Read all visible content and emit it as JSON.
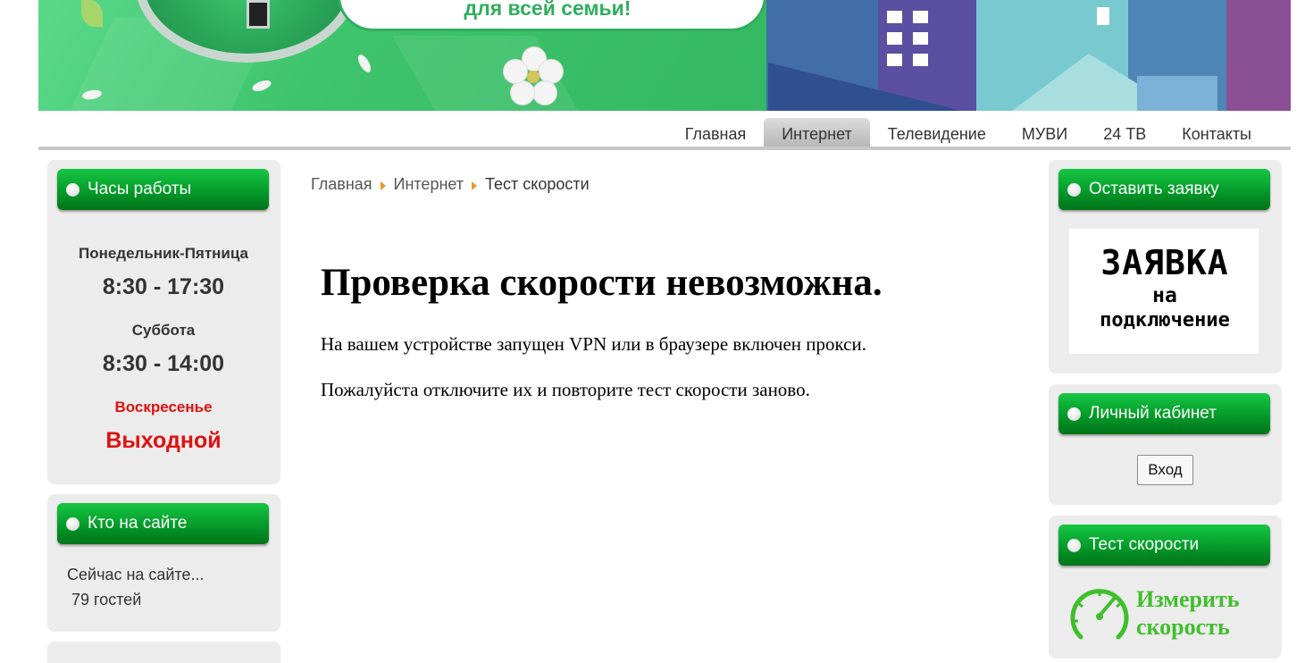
{
  "banner": {
    "slogan": "для всей семьи!"
  },
  "nav": {
    "items": [
      {
        "label": "Главная"
      },
      {
        "label": "Интернет",
        "active": true
      },
      {
        "label": "Телевидение"
      },
      {
        "label": "МУВИ"
      },
      {
        "label": "24 ТВ"
      },
      {
        "label": "Контакты"
      }
    ]
  },
  "left": {
    "hours": {
      "title": "Часы работы",
      "weekdays_label": "Понедельник-Пятница",
      "weekdays_time": "8:30 - 17:30",
      "saturday_label": "Суббота",
      "saturday_time": "8:30 - 14:00",
      "sunday_label": "Воскресенье",
      "sunday_status": "Выходной"
    },
    "online": {
      "title": "Кто на сайте",
      "text": "Сейчас на сайте...",
      "guests": "79 гостей"
    }
  },
  "breadcrumb": {
    "items": [
      "Главная",
      "Интернет",
      "Тест скорости"
    ]
  },
  "main": {
    "title": "Проверка скорости невозможна.",
    "p1": "На вашем устройстве запущен VPN или в браузере включен прокси.",
    "p2": "Пожалуйста отключите их и повторите тест скорости заново."
  },
  "right": {
    "request": {
      "title": "Оставить заявку",
      "banner_line1": "ЗАЯВКА",
      "banner_line2": "на",
      "banner_line3": "подключение"
    },
    "cabinet": {
      "title": "Личный кабинет",
      "login_label": "Вход"
    },
    "speedtest": {
      "title": "Тест скорости",
      "link_line1": "Измерить",
      "link_line2": "скорость"
    }
  },
  "colors": {
    "header_green": "#049a2a",
    "sunday_red": "#e01010",
    "speed_green": "#3fbf2c",
    "breadcrumb_arrow": "#e59a2b"
  }
}
